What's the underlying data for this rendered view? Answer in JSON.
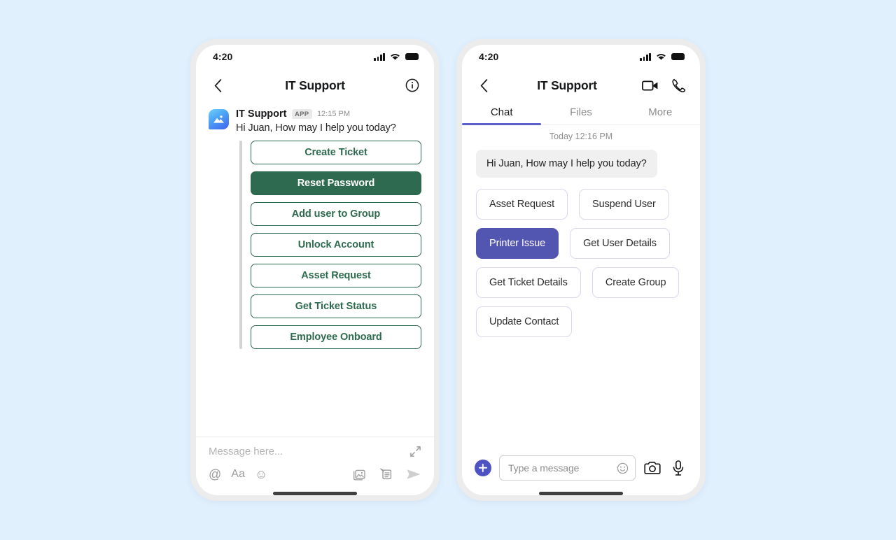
{
  "page": {
    "background_color": "#e1f0fd"
  },
  "colors": {
    "green_accent": "#2d6a4f",
    "purple_accent": "#5356b0",
    "tab_underline": "#5b5fc7",
    "bubble_bg": "#f0f0f0"
  },
  "left_phone": {
    "status": {
      "time": "4:20"
    },
    "header": {
      "back_icon": "chevron-left-icon",
      "title": "IT Support",
      "info_icon": "info-circle-icon"
    },
    "message": {
      "avatar_icon": "app-image-icon",
      "sender": "IT Support",
      "badge": "APP",
      "time": "12:15 PM",
      "text": "Hi Juan, How may I help you today?"
    },
    "actions": [
      {
        "label": "Create Ticket",
        "selected": false
      },
      {
        "label": "Reset Password",
        "selected": true
      },
      {
        "label": "Add user to Group",
        "selected": false
      },
      {
        "label": "Unlock Account",
        "selected": false
      },
      {
        "label": "Asset Request",
        "selected": false
      },
      {
        "label": "Get Ticket Status",
        "selected": false
      },
      {
        "label": "Employee Onboard",
        "selected": false
      }
    ],
    "composer": {
      "placeholder": "Message here...",
      "expand_icon": "expand-arrows-icon",
      "mention_icon": "at-sign-icon",
      "format_icon": "text-format-icon",
      "emoji_icon": "emoji-smiley-icon",
      "image_icon": "image-stack-icon",
      "attach_icon": "sticker-note-icon",
      "send_icon": "send-arrow-icon"
    }
  },
  "right_phone": {
    "status": {
      "time": "4:20"
    },
    "header": {
      "back_icon": "chevron-left-icon",
      "title": "IT Support",
      "video_icon": "video-camera-icon",
      "call_icon": "phone-handset-icon"
    },
    "tabs": [
      {
        "label": "Chat",
        "active": true
      },
      {
        "label": "Files",
        "active": false
      },
      {
        "label": "More",
        "active": false
      }
    ],
    "daystamp": "Today 12:16 PM",
    "bubble_text": "Hi Juan, How may I help you today?",
    "chip_rows": [
      [
        {
          "label": "Asset Request",
          "selected": false
        },
        {
          "label": "Suspend User",
          "selected": false
        }
      ],
      [
        {
          "label": "Printer Issue",
          "selected": true
        },
        {
          "label": "Get User Details",
          "selected": false
        }
      ],
      [
        {
          "label": "Get Ticket Details",
          "selected": false
        },
        {
          "label": "Create Group",
          "selected": false
        }
      ],
      [
        {
          "label": "Update Contact",
          "selected": false
        }
      ]
    ],
    "composer": {
      "plus_icon": "plus-circle-icon",
      "placeholder": "Type a message",
      "emoji_icon": "emoji-smiley-icon",
      "camera_icon": "camera-icon",
      "mic_icon": "microphone-icon"
    }
  }
}
